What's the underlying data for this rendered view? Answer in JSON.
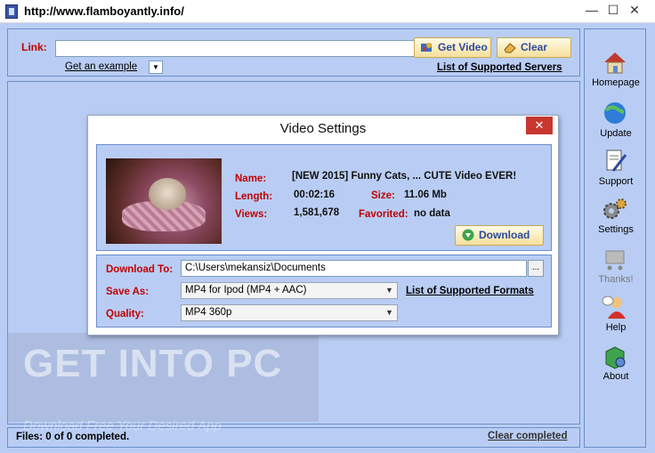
{
  "window": {
    "title": "http://www.flamboyantly.info/",
    "min_label": "—",
    "max_label": "☐",
    "close_label": "✕"
  },
  "link_panel": {
    "label": "Link:",
    "input_value": "",
    "example_label": "Get an example",
    "get_video_label": "Get Video",
    "clear_label": "Clear",
    "servers_link": "List of Supported Servers"
  },
  "sidebar": {
    "items": [
      {
        "label": "Homepage",
        "icon": "home-icon"
      },
      {
        "label": "Update",
        "icon": "update-globe-icon"
      },
      {
        "label": "Support",
        "icon": "support-document-icon"
      },
      {
        "label": "Settings",
        "icon": "gears-icon"
      },
      {
        "label": "Thanks!",
        "icon": "cart-icon",
        "disabled": true
      },
      {
        "label": "Help",
        "icon": "help-person-icon"
      },
      {
        "label": "About",
        "icon": "about-box-icon"
      }
    ]
  },
  "status": {
    "files": "Files: 0 of 0 completed.",
    "clear_completed": "Clear completed"
  },
  "dialog": {
    "title": "Video Settings",
    "close_label": "✕",
    "name_label": "Name:",
    "name_value": "[NEW 2015] Funny Cats, ... CUTE Video EVER!",
    "length_label": "Length:",
    "length_value": "00:02:16",
    "size_label": "Size:",
    "size_value": "11.06 Mb",
    "views_label": "Views:",
    "views_value": "1,581,678",
    "favorited_label": "Favorited:",
    "favorited_value": "no data",
    "download_label": "Download",
    "download_to_label": "Download To:",
    "download_to_value": "C:\\Users\\mekansiz\\Documents",
    "browse_label": "...",
    "save_as_label": "Save As:",
    "save_as_value": "MP4 for Ipod (MP4 + AAC)",
    "formats_link": "List of Supported Formats",
    "quality_label": "Quality:",
    "quality_value": "MP4 360p"
  },
  "watermark": {
    "big": "GET INTO PC",
    "small": "Download Free Your Desired App"
  }
}
